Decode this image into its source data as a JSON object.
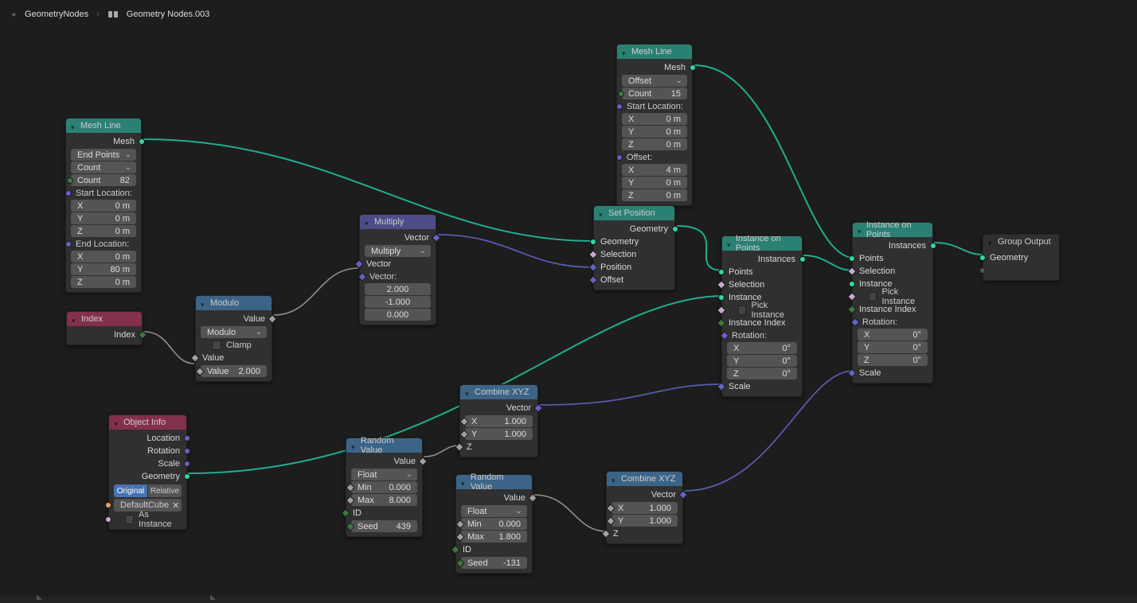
{
  "breadcrumb": {
    "root": "GeometryNodes",
    "leaf": "Geometry Nodes.003"
  },
  "nodes": {
    "meshline1": {
      "title": "Mesh Line",
      "out_mesh": "Mesh",
      "mode": "End Points",
      "count_mode": "Count",
      "count_label": "Count",
      "count": "82",
      "start_label": "Start Location:",
      "sx_k": "X",
      "sx_v": "0 m",
      "sy_k": "Y",
      "sy_v": "0 m",
      "sz_k": "Z",
      "sz_v": "0 m",
      "end_label": "End Location:",
      "ex_k": "X",
      "ex_v": "0 m",
      "ey_k": "Y",
      "ey_v": "80 m",
      "ez_k": "Z",
      "ez_v": "0 m"
    },
    "meshline2": {
      "title": "Mesh Line",
      "out_mesh": "Mesh",
      "mode": "Offset",
      "count_label": "Count",
      "count": "15",
      "start_label": "Start Location:",
      "sx_k": "X",
      "sx_v": "0 m",
      "sy_k": "Y",
      "sy_v": "0 m",
      "sz_k": "Z",
      "sz_v": "0 m",
      "off_label": "Offset:",
      "ox_k": "X",
      "ox_v": "4 m",
      "oy_k": "Y",
      "oy_v": "0 m",
      "oz_k": "Z",
      "oz_v": "0 m"
    },
    "index": {
      "title": "Index",
      "out": "Index"
    },
    "modulo": {
      "title": "Modulo",
      "out": "Value",
      "op": "Modulo",
      "clamp": "Clamp",
      "in_value": "Value",
      "val2_k": "Value",
      "val2_v": "2.000"
    },
    "multiply": {
      "title": "Multiply",
      "out": "Vector",
      "op": "Multiply",
      "in_vec": "Vector",
      "vec_label": "Vector:",
      "vx": "2.000",
      "vy": "-1.000",
      "vz": "0.000"
    },
    "setpos": {
      "title": "Set Position",
      "out": "Geometry",
      "in_geom": "Geometry",
      "in_sel": "Selection",
      "in_pos": "Position",
      "in_off": "Offset"
    },
    "objinfo": {
      "title": "Object Info",
      "out_loc": "Location",
      "out_rot": "Rotation",
      "out_scale": "Scale",
      "out_geom": "Geometry",
      "mode_a": "Original",
      "mode_b": "Relative",
      "obj": "DefaultCube",
      "as_instance": "As Instance"
    },
    "rand1": {
      "title": "Random Value",
      "out": "Value",
      "type": "Float",
      "min_k": "Min",
      "min_v": "0.000",
      "max_k": "Max",
      "max_v": "8.000",
      "id": "ID",
      "seed_k": "Seed",
      "seed_v": "439"
    },
    "rand2": {
      "title": "Random Value",
      "out": "Value",
      "type": "Float",
      "min_k": "Min",
      "min_v": "0.000",
      "max_k": "Max",
      "max_v": "1.800",
      "id": "ID",
      "seed_k": "Seed",
      "seed_v": "-131"
    },
    "cxyz1": {
      "title": "Combine XYZ",
      "out": "Vector",
      "x_k": "X",
      "x_v": "1.000",
      "y_k": "Y",
      "y_v": "1.000",
      "z": "Z"
    },
    "cxyz2": {
      "title": "Combine XYZ",
      "out": "Vector",
      "x_k": "X",
      "x_v": "1.000",
      "y_k": "Y",
      "y_v": "1.000",
      "z": "Z"
    },
    "iop1": {
      "title": "Instance on Points",
      "out": "Instances",
      "pts": "Points",
      "sel": "Selection",
      "inst": "Instance",
      "pick": "Pick Instance",
      "idx": "Instance Index",
      "rot_label": "Rotation:",
      "rx_k": "X",
      "rx_v": "0°",
      "ry_k": "Y",
      "ry_v": "0°",
      "rz_k": "Z",
      "rz_v": "0°",
      "scale": "Scale"
    },
    "iop2": {
      "title": "Instance on Points",
      "out": "Instances",
      "pts": "Points",
      "sel": "Selection",
      "inst": "Instance",
      "pick": "Pick Instance",
      "idx": "Instance Index",
      "rot_label": "Rotation:",
      "rx_k": "X",
      "rx_v": "0°",
      "ry_k": "Y",
      "ry_v": "0°",
      "rz_k": "Z",
      "rz_v": "0°",
      "scale": "Scale"
    },
    "groupout": {
      "title": "Group Output",
      "geom": "Geometry"
    }
  }
}
